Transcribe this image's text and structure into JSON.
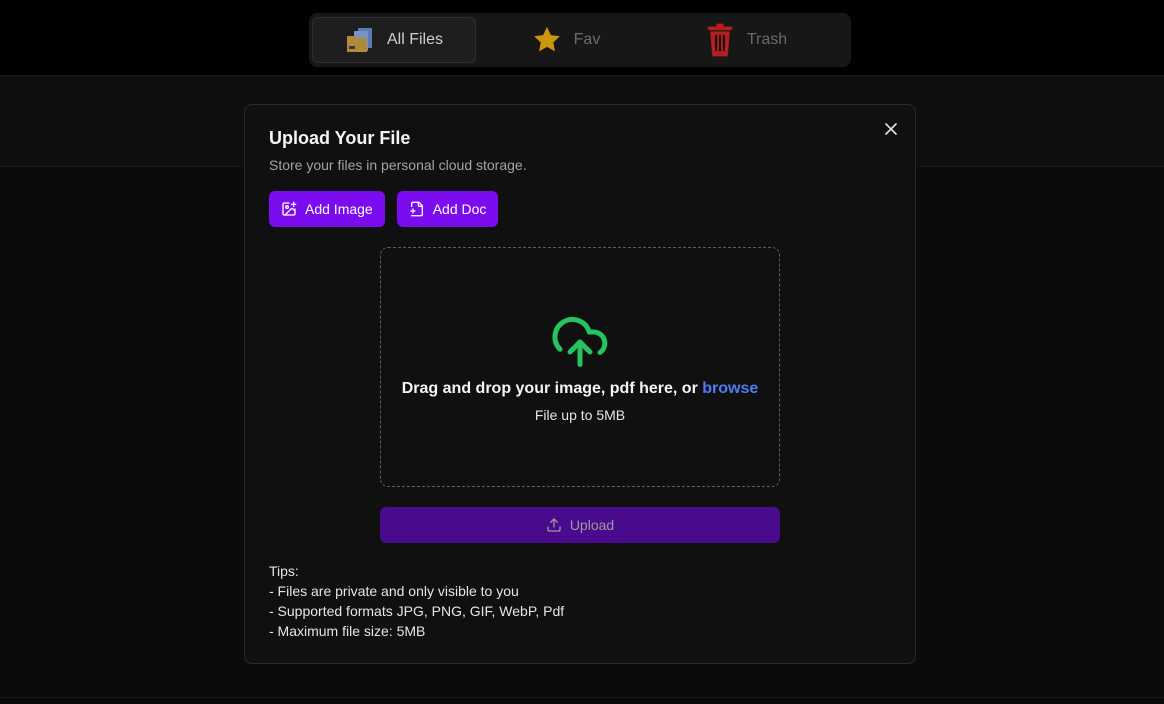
{
  "nav": {
    "tabs": [
      {
        "label": "All Files",
        "icon": "folders-icon",
        "active": true
      },
      {
        "label": "Fav",
        "icon": "star-icon",
        "active": false
      },
      {
        "label": "Trash",
        "icon": "trash-icon",
        "active": false
      }
    ]
  },
  "modal": {
    "title": "Upload Your File",
    "subtitle": "Store your files in personal cloud storage.",
    "add_image_label": "Add Image",
    "add_doc_label": "Add Doc",
    "close_icon": "close-icon",
    "dropzone": {
      "main_text": "Drag and drop your image, pdf here, or ",
      "browse_text": "browse",
      "sub_text": "File up to 5MB",
      "icon": "cloud-upload-icon"
    },
    "upload_label": "Upload",
    "tips": [
      "Tips:",
      "- Files are private and only visible to you",
      "- Supported formats JPG, PNG, GIF, WebP, Pdf",
      "- Maximum file size: 5MB"
    ]
  },
  "colors": {
    "primary": "#7c0cf0",
    "primary_disabled": "#4a0a8e",
    "link": "#4a7cf4",
    "upload_icon": "#22c55e",
    "star": "#c9960c",
    "trash": "#b91c1c"
  }
}
